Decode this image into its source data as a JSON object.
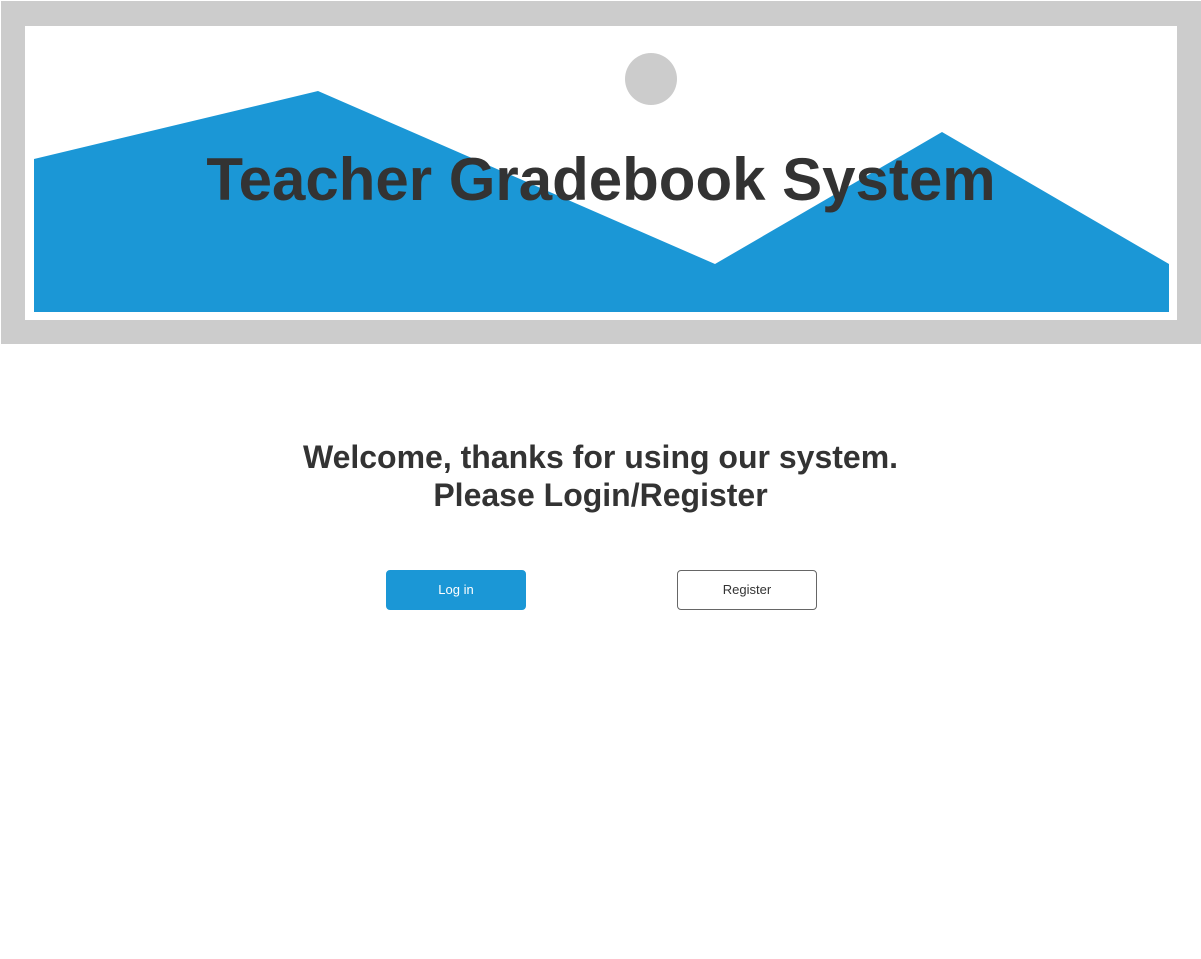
{
  "banner": {
    "title": "Teacher Gradebook System",
    "image_icon": "image-placeholder-icon",
    "colors": {
      "frame": "#cccccc",
      "mountain": "#1b97d6",
      "sun": "#cccccc"
    }
  },
  "welcome": {
    "line1": "Welcome, thanks for using our system.",
    "line2": "Please Login/Register"
  },
  "actions": {
    "login_label": "Log in",
    "register_label": "Register",
    "colors": {
      "primary": "#1b97d6"
    }
  }
}
